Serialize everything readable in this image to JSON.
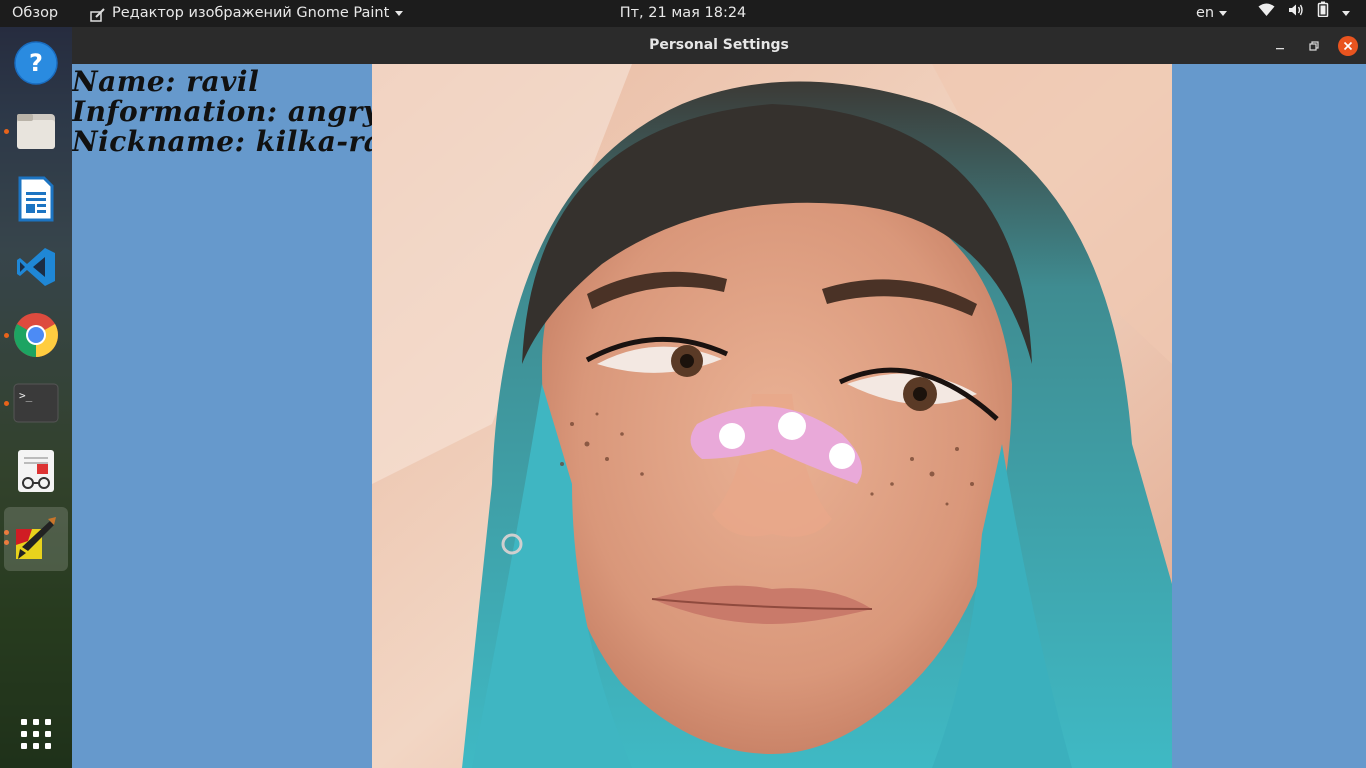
{
  "topbar": {
    "overview": "Обзор",
    "app_menu": "Редактор изображений Gnome Paint",
    "clock": "Пт, 21 мая  18:24",
    "language": "en",
    "icons": [
      "wifi-icon",
      "volume-icon",
      "battery-icon",
      "power-menu-caret-icon"
    ]
  },
  "dock": {
    "items": [
      {
        "name": "help-icon",
        "running": false
      },
      {
        "name": "files-icon",
        "running": true
      },
      {
        "name": "libreoffice-writer-icon",
        "running": false
      },
      {
        "name": "vscode-icon",
        "running": false
      },
      {
        "name": "chrome-icon",
        "running": true
      },
      {
        "name": "terminal-icon",
        "running": true
      },
      {
        "name": "document-viewer-icon",
        "running": false
      },
      {
        "name": "gnome-paint-icon",
        "running": true,
        "active": true
      }
    ],
    "show_apps": "show-applications-icon"
  },
  "window": {
    "title": "Personal Settings",
    "controls": [
      "minimize",
      "maximize",
      "close"
    ],
    "background_color": "#6699cc"
  },
  "profile": {
    "name_line": "Name: ravil",
    "information_line": "Information: angry",
    "nickname_line": "Nickname: kilka-rav"
  },
  "photo": {
    "description_icon": "portrait-photo"
  }
}
